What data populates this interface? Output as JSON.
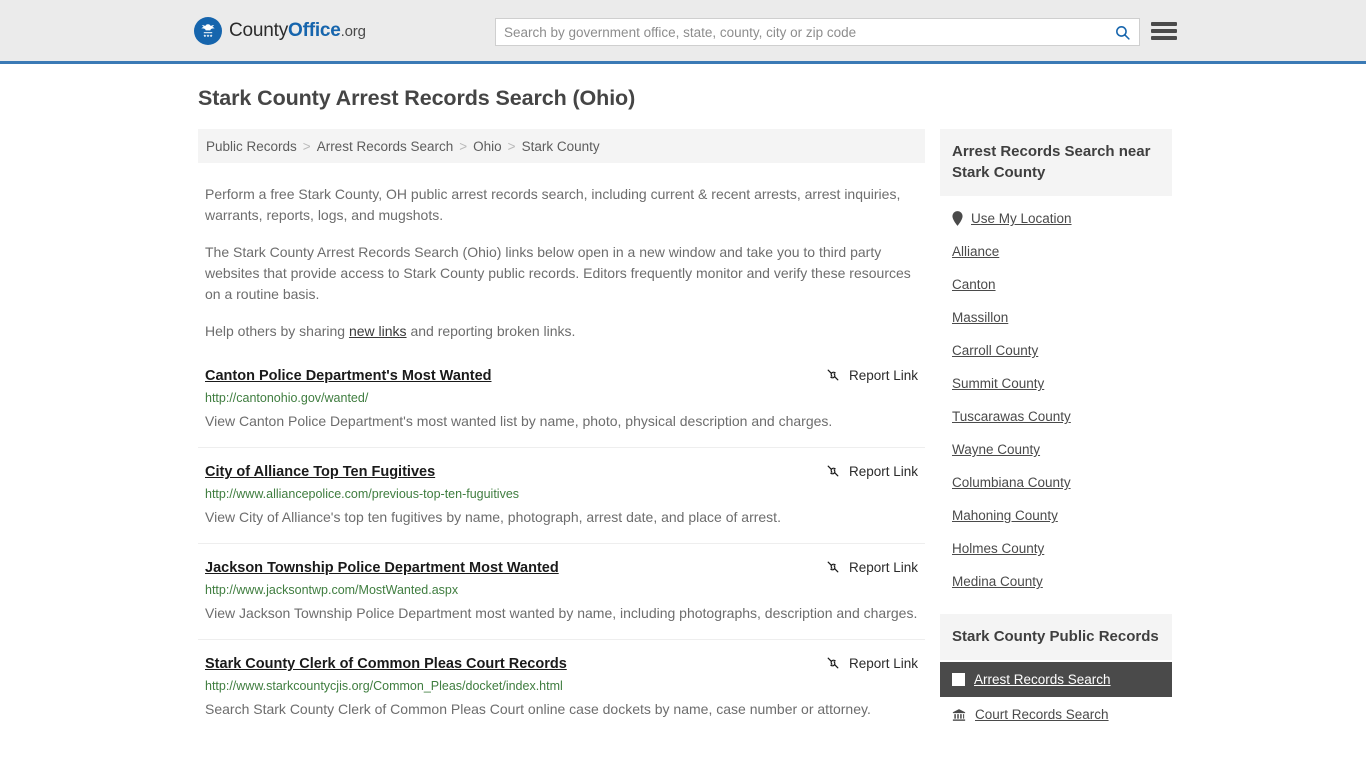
{
  "header": {
    "logo": {
      "icon": "eagle-shield-icon",
      "text_part1": "County",
      "text_part2": "Office",
      "text_part3": ".org"
    },
    "search": {
      "placeholder": "Search by government office, state, county, city or zip code",
      "value": "",
      "icon": "search-icon"
    },
    "menu_icon": "hamburger-menu-icon",
    "border_color": "#3b7ab5",
    "background": "#ebebeb"
  },
  "page_title": "Stark County Arrest Records Search (Ohio)",
  "breadcrumb": {
    "items": [
      "Public Records",
      "Arrest Records Search",
      "Ohio",
      "Stark County"
    ],
    "separator": ">"
  },
  "intro": {
    "p1": "Perform a free Stark County, OH public arrest records search, including current & recent arrests, arrest inquiries, warrants, reports, logs, and mugshots.",
    "p2": "The Stark County Arrest Records Search (Ohio) links below open in a new window and take you to third party websites that provide access to Stark County public records. Editors frequently monitor and verify these resources on a routine basis.",
    "p3_before": "Help others by sharing ",
    "p3_link": "new links",
    "p3_after": " and reporting broken links."
  },
  "results": {
    "report_label": "Report Link",
    "report_icon": "broken-link-icon",
    "items": [
      {
        "title": "Canton Police Department's Most Wanted",
        "url": "http://cantonohio.gov/wanted/",
        "description": "View Canton Police Department's most wanted list by name, photo, physical description and charges."
      },
      {
        "title": "City of Alliance Top Ten Fugitives",
        "url": "http://www.alliancepolice.com/previous-top-ten-fuguitives",
        "description": "View City of Alliance's top ten fugitives by name, photograph, arrest date, and place of arrest."
      },
      {
        "title": "Jackson Township Police Department Most Wanted",
        "url": "http://www.jacksontwp.com/MostWanted.aspx",
        "description": "View Jackson Township Police Department most wanted by name, including photographs, description and charges."
      },
      {
        "title": "Stark County Clerk of Common Pleas Court Records",
        "url": "http://www.starkcountycjis.org/Common_Pleas/docket/index.html",
        "description": "Search Stark County Clerk of Common Pleas Court online case dockets by name, case number or attorney."
      }
    ]
  },
  "sidebar": {
    "nearby": {
      "heading": "Arrest Records Search near Stark County",
      "use_my_location": {
        "label": "Use My Location",
        "icon": "map-pin-icon"
      },
      "links": [
        "Alliance",
        "Canton",
        "Massillon",
        "Carroll County",
        "Summit County",
        "Tuscarawas County",
        "Wayne County",
        "Columbiana County",
        "Mahoning County",
        "Holmes County",
        "Medina County"
      ]
    },
    "public_records": {
      "heading": "Stark County Public Records",
      "items": [
        {
          "label": "Arrest Records Search",
          "icon": "white-square-icon",
          "active": true
        },
        {
          "label": "Court Records Search",
          "icon": "courthouse-icon",
          "active": false
        }
      ]
    }
  }
}
